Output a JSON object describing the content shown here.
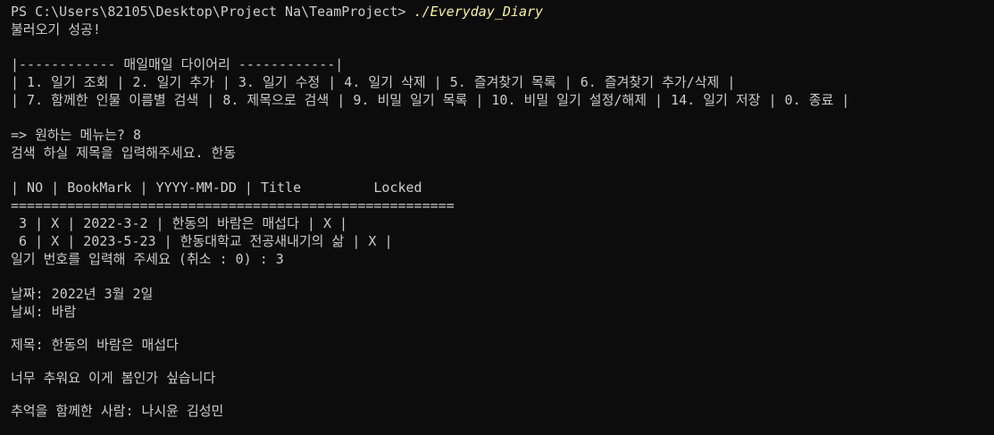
{
  "prompt": {
    "path": "PS C:\\Users\\82105\\Desktop\\Project Na\\TeamProject> ",
    "command": "./Everyday_Diary"
  },
  "load_message": "불러오기 성공!",
  "menu": {
    "title_line": "|------------ 매일매일 다이어리 ------------|",
    "row1": "| 1. 일기 조회 | 2. 일기 추가 | 3. 일기 수정 | 4. 일기 삭제 | 5. 즐겨찾기 목록 | 6. 즐겨찾기 추가/삭제 |",
    "row2": "| 7. 함께한 인물 이름별 검색 | 8. 제목으로 검색 | 9. 비밀 일기 목록 | 10. 비밀 일기 설정/해제 | 14. 일기 저장 | 0. 종료 |"
  },
  "menu_prompt": "=> 원하는 메뉴는? 8",
  "search_prompt": "검색 하실 제목을 입력해주세요. 한동",
  "table": {
    "header": "| NO | BookMark | YYYY-MM-DD | Title         Locked",
    "separator": "=======================================================",
    "rows": [
      " 3 | X | 2022-3-2 | 한동의 바람은 매섭다 | X |",
      " 6 | X | 2023-5-23 | 한동대학교 전공새내기의 삶 | X |"
    ]
  },
  "select_prompt": "일기 번호를 입력해 주세요 (취소 : 0) : 3",
  "entry": {
    "date": "날짜: 2022년 3월 2일",
    "weather": "날씨: 바람",
    "title": "제목: 한동의 바람은 매섭다",
    "body": "너무 추워요 이게 봄인가 싶습니다",
    "people": "추억을 함께한 사람: 나시윤 김성민"
  },
  "colors": {
    "background": "#0c0c0c",
    "text": "#cccccc",
    "command": "#f9f1a5"
  }
}
